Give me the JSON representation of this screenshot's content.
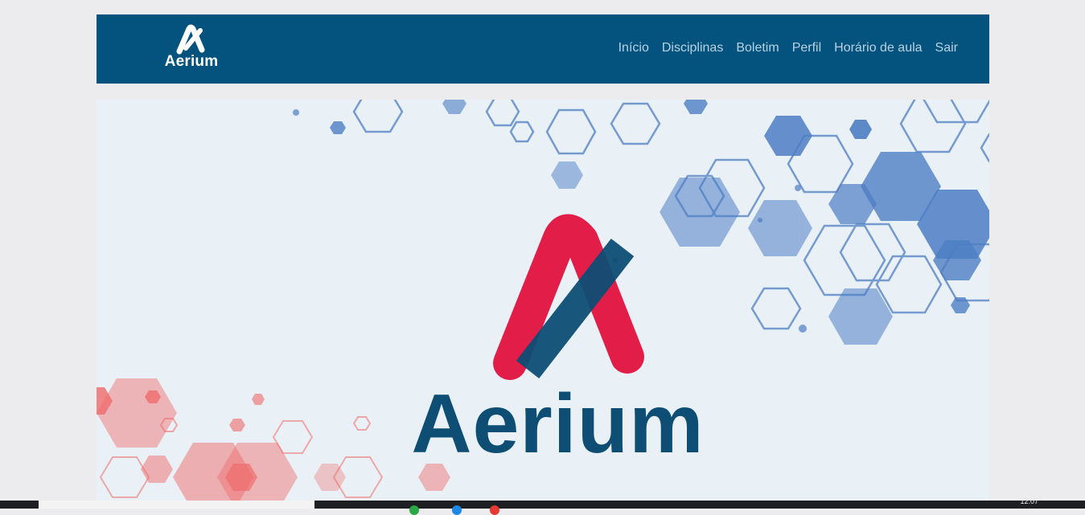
{
  "navbar": {
    "brand_text": "Aerium",
    "links": [
      "Início",
      "Disciplinas",
      "Boletim",
      "Perfil",
      "Horário de aula",
      "Sair"
    ]
  },
  "banner": {
    "title": "Aerium",
    "colors": {
      "red": "#e11d48",
      "navy": "#0e4d74",
      "blue_hex": "#4d7ec4"
    }
  },
  "taskbar": {
    "clock": "12:07"
  },
  "colors": {
    "navbar_bg": "#03537e",
    "nav_link": "#b9d2e3",
    "page_bg": "#ececef"
  }
}
